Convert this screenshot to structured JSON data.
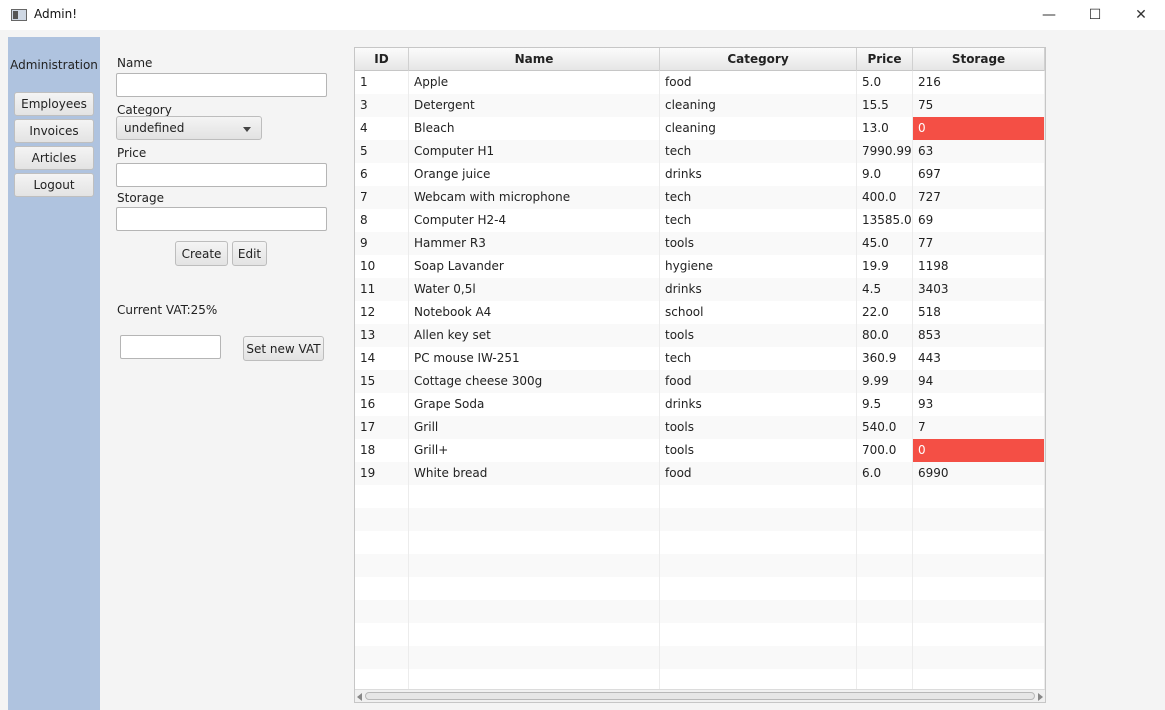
{
  "window": {
    "title": "Admin!",
    "minimize_glyph": "—",
    "maximize_glyph": "☐",
    "close_glyph": "✕"
  },
  "sidebar": {
    "title": "Administration",
    "items": [
      {
        "label": "Employees"
      },
      {
        "label": "Invoices"
      },
      {
        "label": "Articles"
      },
      {
        "label": "Logout"
      }
    ]
  },
  "form": {
    "name_label": "Name",
    "name_value": "",
    "category_label": "Category",
    "category_selected": "undefined",
    "price_label": "Price",
    "price_value": "",
    "storage_label": "Storage",
    "storage_value": "",
    "create_label": "Create",
    "edit_label": "Edit",
    "current_vat": "Current VAT:25%",
    "vat_value": "",
    "set_vat_label": "Set new VAT"
  },
  "table": {
    "columns": [
      "ID",
      "Name",
      "Category",
      "Price",
      "Storage"
    ],
    "alert_color": "#f44f45",
    "rows": [
      {
        "id": "1",
        "name": "Apple",
        "category": "food",
        "price": "5.0",
        "storage": "216",
        "alert": false
      },
      {
        "id": "3",
        "name": "Detergent",
        "category": "cleaning",
        "price": "15.5",
        "storage": "75",
        "alert": false
      },
      {
        "id": "4",
        "name": "Bleach",
        "category": "cleaning",
        "price": "13.0",
        "storage": "0",
        "alert": true
      },
      {
        "id": "5",
        "name": "Computer H1",
        "category": "tech",
        "price": "7990.99",
        "storage": "63",
        "alert": false
      },
      {
        "id": "6",
        "name": "Orange juice",
        "category": "drinks",
        "price": "9.0",
        "storage": "697",
        "alert": false
      },
      {
        "id": "7",
        "name": "Webcam with microphone",
        "category": "tech",
        "price": "400.0",
        "storage": "727",
        "alert": false
      },
      {
        "id": "8",
        "name": "Computer H2-4",
        "category": "tech",
        "price": "13585.0",
        "storage": "69",
        "alert": false
      },
      {
        "id": "9",
        "name": "Hammer R3",
        "category": "tools",
        "price": "45.0",
        "storage": "77",
        "alert": false
      },
      {
        "id": "10",
        "name": "Soap Lavander",
        "category": "hygiene",
        "price": "19.9",
        "storage": "1198",
        "alert": false
      },
      {
        "id": "11",
        "name": "Water 0,5l",
        "category": "drinks",
        "price": "4.5",
        "storage": "3403",
        "alert": false
      },
      {
        "id": "12",
        "name": "Notebook A4",
        "category": "school",
        "price": "22.0",
        "storage": "518",
        "alert": false
      },
      {
        "id": "13",
        "name": "Allen key set",
        "category": "tools",
        "price": "80.0",
        "storage": "853",
        "alert": false
      },
      {
        "id": "14",
        "name": "PC mouse IW-251",
        "category": "tech",
        "price": "360.9",
        "storage": "443",
        "alert": false
      },
      {
        "id": "15",
        "name": "Cottage cheese 300g",
        "category": "food",
        "price": "9.99",
        "storage": "94",
        "alert": false
      },
      {
        "id": "16",
        "name": "Grape Soda",
        "category": "drinks",
        "price": "9.5",
        "storage": "93",
        "alert": false
      },
      {
        "id": "17",
        "name": "Grill",
        "category": "tools",
        "price": "540.0",
        "storage": "7",
        "alert": false
      },
      {
        "id": "18",
        "name": "Grill+",
        "category": "tools",
        "price": "700.0",
        "storage": "0",
        "alert": true
      },
      {
        "id": "19",
        "name": "White bread",
        "category": "food",
        "price": "6.0",
        "storage": "6990",
        "alert": false
      }
    ]
  }
}
